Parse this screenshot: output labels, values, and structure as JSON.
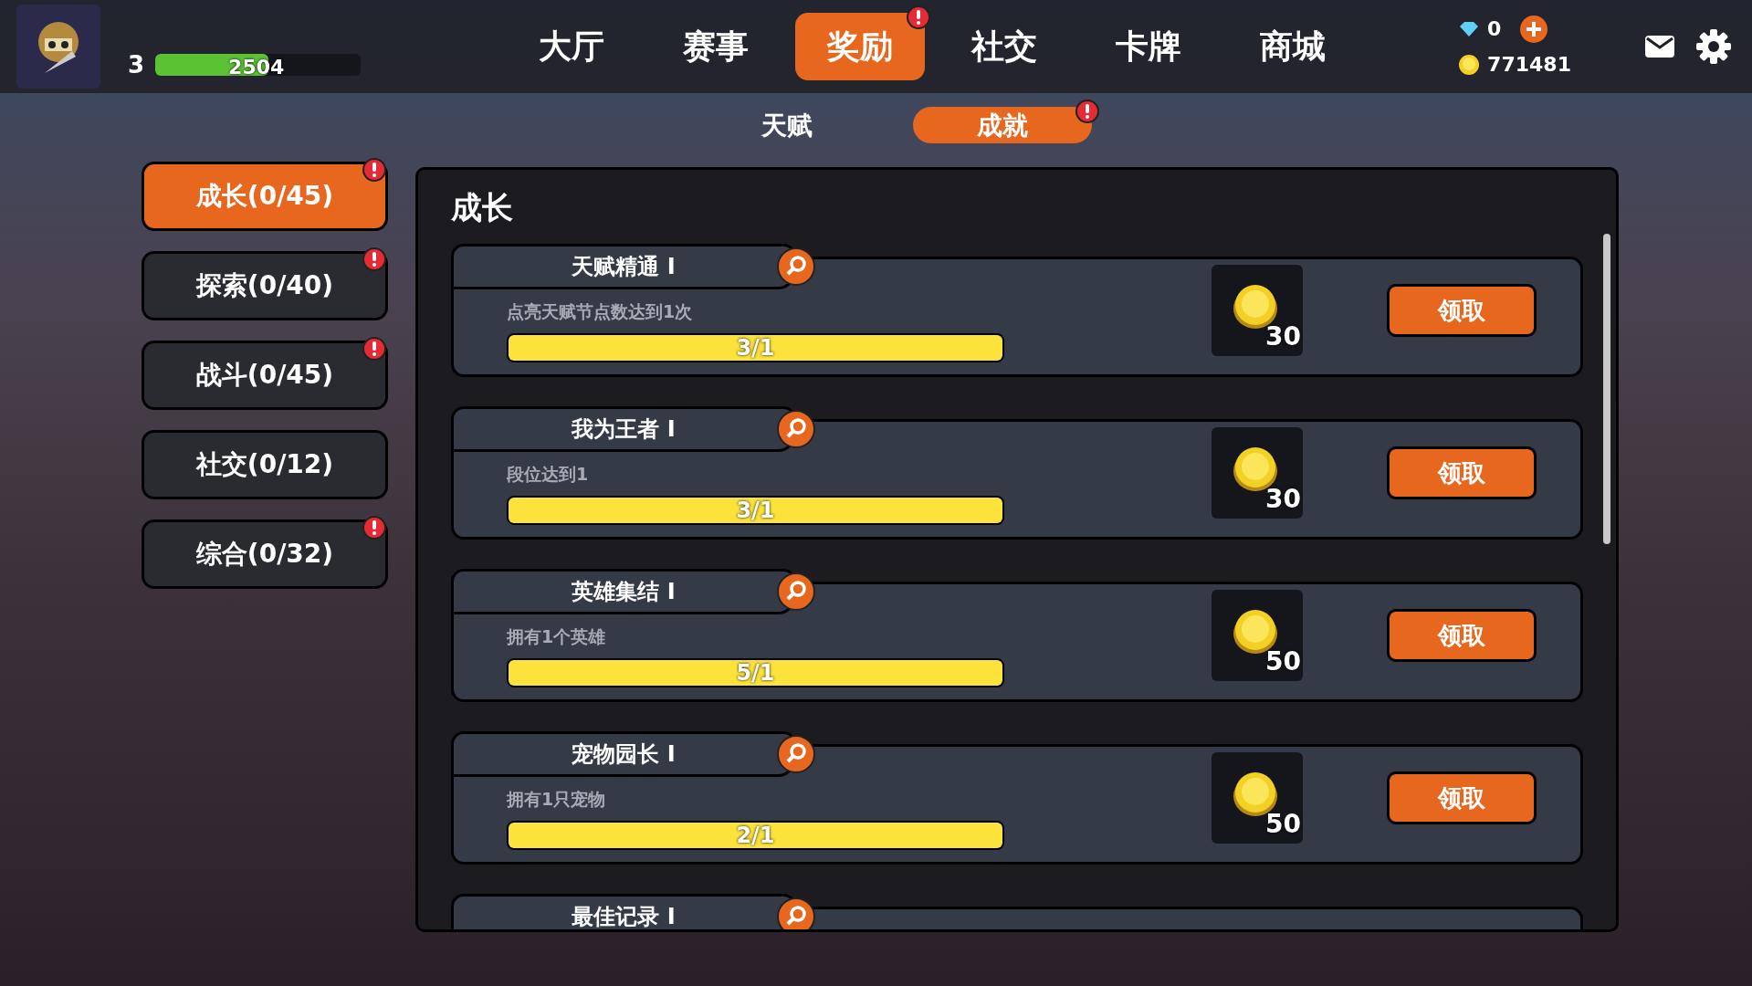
{
  "player": {
    "rank": "3",
    "xp": {
      "level": 0.55,
      "value": "2504"
    }
  },
  "nav_tabs": [
    {
      "label": "大厅",
      "selected": false,
      "alert": false
    },
    {
      "label": "赛事",
      "selected": false,
      "alert": false
    },
    {
      "label": "奖励",
      "selected": true,
      "alert": true
    },
    {
      "label": "社交",
      "selected": false,
      "alert": false
    },
    {
      "label": "卡牌",
      "selected": false,
      "alert": false
    },
    {
      "label": "商城",
      "selected": false,
      "alert": false
    }
  ],
  "currency": {
    "gems": "0",
    "coins": "771481"
  },
  "sub_tabs": [
    {
      "label": "天赋",
      "selected": false,
      "alert": false
    },
    {
      "label": "成就",
      "selected": true,
      "alert": true
    }
  ],
  "categories": [
    {
      "label": "成长(0/45)",
      "selected": true,
      "alert": true
    },
    {
      "label": "探索(0/40)",
      "selected": false,
      "alert": true
    },
    {
      "label": "战斗(0/45)",
      "selected": false,
      "alert": true
    },
    {
      "label": "社交(0/12)",
      "selected": false,
      "alert": false
    },
    {
      "label": "综合(0/32)",
      "selected": false,
      "alert": true
    }
  ],
  "panel_title": "成长",
  "achievements": [
    {
      "title": "天赋精通 Ⅰ",
      "description": "点亮天赋节点数达到1次",
      "level": 1,
      "progress": "3/1",
      "reward": "30",
      "button": "领取"
    },
    {
      "title": "我为王者 Ⅰ",
      "description": "段位达到1",
      "level": 1,
      "progress": "3/1",
      "reward": "30",
      "button": "领取"
    },
    {
      "title": "英雄集结 Ⅰ",
      "description": "拥有1个英雄",
      "level": 1,
      "progress": "5/1",
      "reward": "50",
      "button": "领取"
    },
    {
      "title": "宠物园长 Ⅰ",
      "description": "拥有1只宠物",
      "level": 1,
      "progress": "2/1",
      "reward": "50",
      "button": "领取"
    },
    {
      "title": "最佳记录 Ⅰ"
    }
  ]
}
